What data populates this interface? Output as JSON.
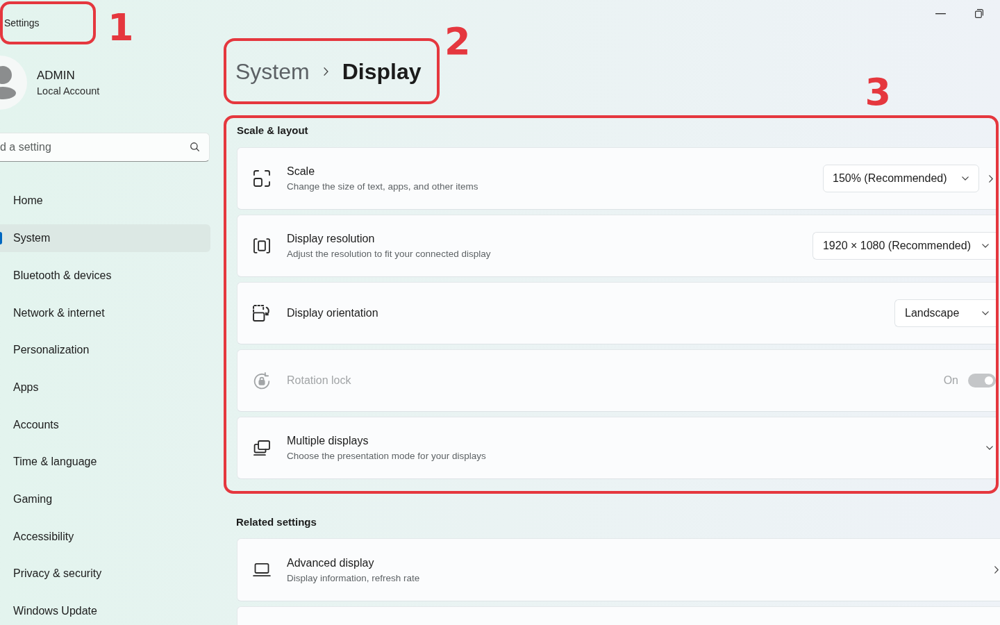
{
  "window": {
    "title": "Settings",
    "annotation": "1"
  },
  "account": {
    "name": "ADMIN",
    "type": "Local Account"
  },
  "search": {
    "placeholder": "d a setting"
  },
  "sidebar": {
    "items": [
      {
        "label": "Home",
        "selected": false
      },
      {
        "label": "System",
        "selected": true
      },
      {
        "label": "Bluetooth & devices",
        "selected": false
      },
      {
        "label": "Network & internet",
        "selected": false
      },
      {
        "label": "Personalization",
        "selected": false
      },
      {
        "label": "Apps",
        "selected": false
      },
      {
        "label": "Accounts",
        "selected": false
      },
      {
        "label": "Time & language",
        "selected": false
      },
      {
        "label": "Gaming",
        "selected": false
      },
      {
        "label": "Accessibility",
        "selected": false
      },
      {
        "label": "Privacy & security",
        "selected": false
      },
      {
        "label": "Windows Update",
        "selected": false
      }
    ]
  },
  "breadcrumb": {
    "parent": "System",
    "current": "Display",
    "annotation": "2"
  },
  "scale_layout": {
    "heading": "Scale & layout",
    "annotation": "3",
    "rows": [
      {
        "kind": "dropdown_link",
        "title": "Scale",
        "subtitle": "Change the size of text, apps, and other items",
        "value": "150% (Recommended)",
        "disabled": false
      },
      {
        "kind": "dropdown",
        "title": "Display resolution",
        "subtitle": "Adjust the resolution to fit your connected display",
        "value": "1920 × 1080 (Recommended)",
        "disabled": false
      },
      {
        "kind": "dropdown",
        "title": "Display orientation",
        "value": "Landscape",
        "disabled": false
      },
      {
        "kind": "toggle",
        "title": "Rotation lock",
        "state_label": "On",
        "on": true,
        "disabled": true
      },
      {
        "kind": "expander",
        "title": "Multiple displays",
        "subtitle": "Choose the presentation mode for your displays",
        "expanded": false,
        "disabled": false
      }
    ]
  },
  "related_settings": {
    "heading": "Related settings",
    "rows": [
      {
        "kind": "link",
        "title": "Advanced display",
        "subtitle": "Display information, refresh rate"
      },
      {
        "kind": "blank"
      }
    ]
  }
}
